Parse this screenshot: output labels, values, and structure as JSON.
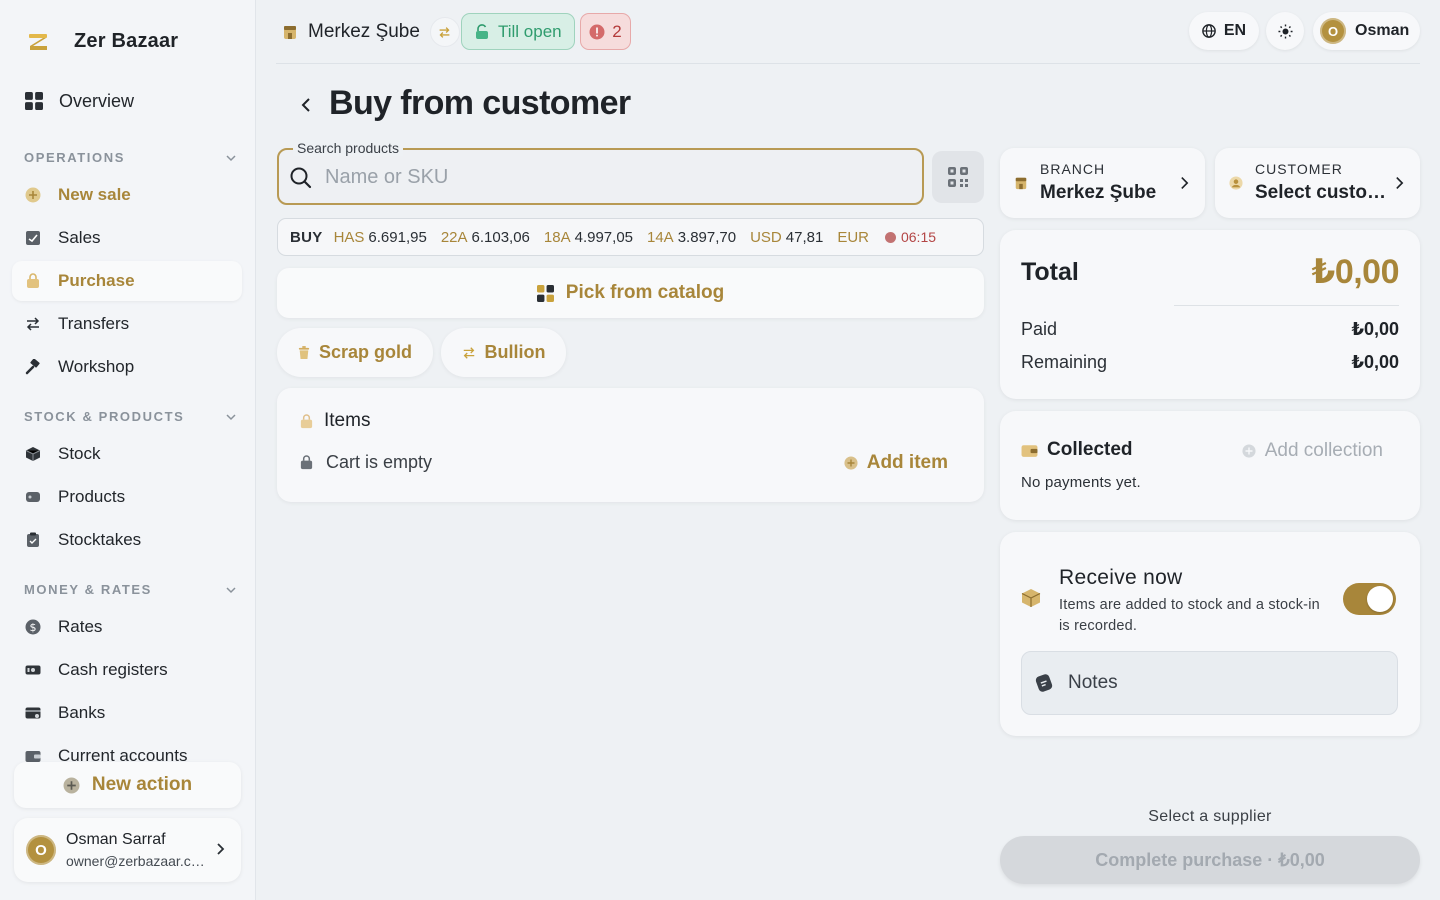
{
  "brand": {
    "name": "Zer Bazaar"
  },
  "sidebar": {
    "overview": "Overview",
    "sections": [
      {
        "title": "OPERATIONS",
        "items": [
          {
            "label": "New sale",
            "icon": "plus-circle-icon"
          },
          {
            "label": "Sales",
            "icon": "receipt-icon"
          },
          {
            "label": "Purchase",
            "icon": "bag-icon"
          },
          {
            "label": "Transfers",
            "icon": "swap-icon"
          },
          {
            "label": "Workshop",
            "icon": "hammer-icon"
          }
        ]
      },
      {
        "title": "STOCK & PRODUCTS",
        "items": [
          {
            "label": "Stock",
            "icon": "cube-icon"
          },
          {
            "label": "Products",
            "icon": "tag-icon"
          },
          {
            "label": "Stocktakes",
            "icon": "clipboard-icon"
          }
        ]
      },
      {
        "title": "MONEY & RATES",
        "items": [
          {
            "label": "Rates",
            "icon": "dollar-icon"
          },
          {
            "label": "Cash registers",
            "icon": "banknote-icon"
          },
          {
            "label": "Banks",
            "icon": "bank-icon"
          },
          {
            "label": "Current accounts",
            "icon": "wallet-icon"
          }
        ]
      }
    ],
    "new_action": "New action",
    "user": {
      "initial": "O",
      "name": "Osman Sarraf",
      "email": "owner@zerbazaar.com"
    }
  },
  "topbar": {
    "branch": "Merkez Şube",
    "till": "Till open",
    "alerts": "2",
    "lang": "EN",
    "user_initial": "O",
    "user_name": "Osman"
  },
  "page": {
    "title": "Buy from customer",
    "search": {
      "legend": "Search products",
      "placeholder": "Name or SKU"
    },
    "rates": {
      "label": "BUY",
      "items": [
        {
          "code": "HAS",
          "value": "6.691,95"
        },
        {
          "code": "22A",
          "value": "6.103,06"
        },
        {
          "code": "18A",
          "value": "4.997,05"
        },
        {
          "code": "14A",
          "value": "3.897,70"
        },
        {
          "code": "USD",
          "value": "47,81"
        },
        {
          "code": "EUR",
          "value": ""
        }
      ],
      "time": "06:15"
    },
    "pick_catalog": "Pick from catalog",
    "scrap_gold": "Scrap gold",
    "bullion": "Bullion",
    "items": {
      "title": "Items",
      "empty": "Cart is empty",
      "add": "Add item"
    }
  },
  "summary": {
    "branch": {
      "label": "BRANCH",
      "value": "Merkez Şube"
    },
    "customer": {
      "label": "CUSTOMER",
      "value": "Select customer"
    },
    "total": {
      "label": "Total",
      "value": "₺0,00"
    },
    "paid": {
      "label": "Paid",
      "value": "₺0,00"
    },
    "remaining": {
      "label": "Remaining",
      "value": "₺0,00"
    },
    "collected": {
      "title": "Collected",
      "add": "Add collection",
      "empty": "No payments yet."
    },
    "receive": {
      "title": "Receive now",
      "desc": "Items are added to stock and a stock-in is recorded.",
      "enabled": true
    },
    "notes": "Notes",
    "hint": "Select a supplier",
    "complete": "Complete purchase · ₺0,00"
  },
  "colors": {
    "accent": "#a8863a",
    "success": "#2f9c6e",
    "danger": "#b43b3b"
  }
}
